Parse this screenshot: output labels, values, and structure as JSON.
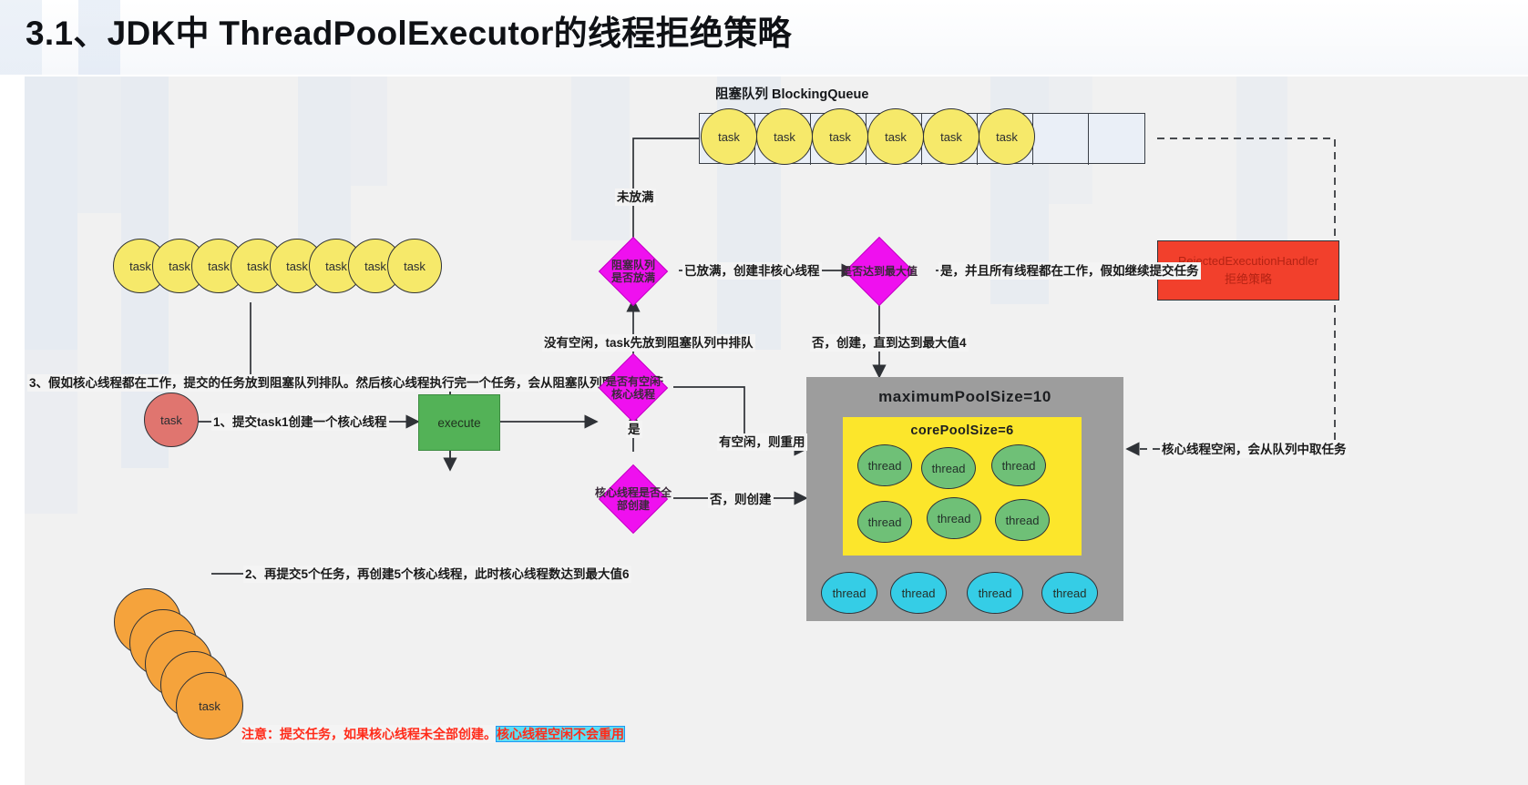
{
  "title": "3.1、JDK中 ThreadPoolExecutor的线程拒绝策略",
  "queue": {
    "title": "阻塞队列 BlockingQueue",
    "task_label": "task",
    "filled_count": 6,
    "empty_count": 2
  },
  "left_tasks": {
    "task_label": "task",
    "count": 8
  },
  "pending_stack": {
    "task_label": "task",
    "count": 5
  },
  "single_task": {
    "task_label": "task"
  },
  "execute": {
    "label": "execute"
  },
  "diamonds": {
    "queue_full": "阻塞队列\n是否放满",
    "queue_full_l1": "阻塞队列",
    "queue_full_l2": "是否放满",
    "max_reached_l1": "是否达到最大值",
    "idle_core_l1": "是否有空闲",
    "idle_core_l2": "核心线程",
    "all_core_created_l1": "核心线程是否全",
    "all_core_created_l2": "部创建"
  },
  "reject": {
    "line1": "RejectedExecutionHandler",
    "line2": "拒绝策略"
  },
  "pool": {
    "outer_title": "maximumPoolSize=10",
    "inner_title": "corePoolSize=6",
    "thread_label": "thread",
    "core_threads": 6,
    "extra_threads": 4
  },
  "edge_labels": {
    "queue_not_full": "未放满",
    "queue_full_create_noncore": "已放满，创建非核心线程",
    "max_reached_submit": "是，并且所有线程都在工作，假如继续提交任务",
    "no_idle_enqueue": "没有空闲，task先放到阻塞队列中排队",
    "not_max_create": "否，创建，直到达到最大值4",
    "yes": "是",
    "idle_reuse": "有空闲，则重用",
    "no_create": "否，则创建",
    "core_idle_take": "核心线程空闲，会从队列中取任务"
  },
  "annotations": {
    "step1": "1、提交task1创建一个核心线程",
    "step2": "2、再提交5个任务，再创建5个核心线程，此时核心线程数达到最大值6",
    "step3": "3、假如核心线程都在工作，提交的任务放到阻塞队列排队。然后核心线程执行完一个任务，会从阻塞队列取任务执行",
    "note_prefix": "注意：提交任务，如果核心线程未全部创建。",
    "note_highlight": "核心线程空闲不会重用"
  },
  "colors": {
    "task_yellow": "#f6e96a",
    "task_red": "#e0756f",
    "task_orange": "#f5a33c",
    "diamond_magenta": "#ef10ef",
    "execute_green": "#53b257",
    "reject_red": "#f2402c",
    "pool_gray": "#9d9d9d",
    "core_yellow": "#fce62b",
    "thread_green": "#6fc077",
    "thread_cyan": "#35cde6",
    "highlight_cyan": "#5ce0f5",
    "note_red": "#ff2b1a"
  }
}
